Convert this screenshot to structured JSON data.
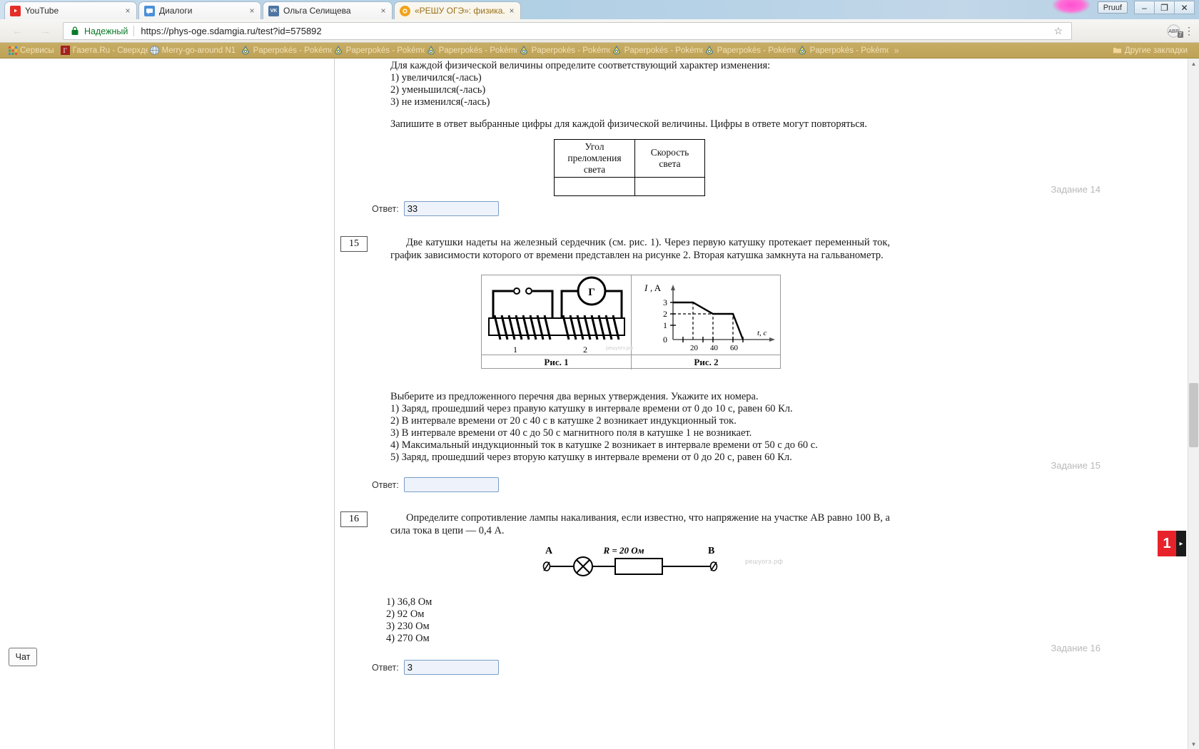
{
  "browser": {
    "tabs": [
      {
        "title": "YouTube",
        "favicon": "youtube-icon",
        "close": "×",
        "active": false
      },
      {
        "title": "Диалоги",
        "favicon": "message-icon",
        "close": "×",
        "active": false
      },
      {
        "title": "Ольга Селищева",
        "favicon": "vk-icon",
        "close": "×",
        "active": false
      },
      {
        "title": "«РЕШУ ОГЭ»: физика. О",
        "favicon": "sun-icon",
        "close": "×",
        "active": true
      }
    ],
    "window_controls": {
      "minimize": "–",
      "maximize": "❐",
      "close": "✕"
    },
    "pruuf_badge": "Pruuf",
    "omnibox": {
      "secure_label": "Надежный",
      "url": "https://phys-oge.sdamgia.ru/test?id=575892",
      "star": "☆",
      "lock": "lock-icon"
    },
    "extensions": {
      "abp_label": "ABP",
      "abp_count": "7",
      "menu": "⋮"
    },
    "bookmarks": [
      {
        "label": "Сервисы",
        "icon": "apps-grid-icon"
      },
      {
        "label": "Газета.Ru - Сверхдер",
        "icon": "gazeta-icon"
      },
      {
        "label": "Merry-go-around N1",
        "icon": "globe-icon"
      },
      {
        "label": "Paperpokés - Pokémo",
        "icon": "pokeball-icon"
      },
      {
        "label": "Paperpokés - Pokémo",
        "icon": "pokeball-icon"
      },
      {
        "label": "Paperpokés - Pokémo",
        "icon": "pokeball-icon"
      },
      {
        "label": "Paperpokés - Pokémo",
        "icon": "pokeball-icon"
      },
      {
        "label": "Paperpokés - Pokémo",
        "icon": "pokeball-icon"
      },
      {
        "label": "Paperpokés - Pokémo",
        "icon": "pokeball-icon"
      },
      {
        "label": "Paperpokés - Pokémo",
        "icon": "pokeball-icon"
      }
    ],
    "bookmarks_overflow": "»",
    "other_bookmarks": {
      "label": "Другие закладки",
      "icon": "folder-icon"
    }
  },
  "task14": {
    "intro": "Для каждой физической величины определите соответствующий характер изменения:",
    "options": [
      "1) увеличился(-лась)",
      "2) уменьшился(-лась)",
      "3) не изменился(-лась)"
    ],
    "instruction": "Запишите в ответ выбранные цифры для каждой физической величины. Цифры в ответе могут повторяться.",
    "table": {
      "headers": [
        "Угол преломления света",
        "Скорость света"
      ],
      "row": [
        "",
        ""
      ]
    },
    "task_label": "Задание 14",
    "answer_label": "Ответ:",
    "answer_value": "33"
  },
  "task15": {
    "number": "15",
    "text": "Две катушки надеты на железный сердечник (см. рис. 1). Через первую катушку протекает переменный ток, график зависимости которого от времени представлен на рисунке 2. Вторая катушка замкнута на гальванометр.",
    "figure": {
      "left_caption": "Рис. 1",
      "right_caption": "Рис. 2",
      "coil_labels": [
        "1",
        "2"
      ],
      "galvanometer_label": "Г",
      "watermark": "решуогэ.рф"
    },
    "chart_data": {
      "type": "line",
      "title": "",
      "xlabel": "t, с",
      "ylabel": "I, A",
      "x": [
        0,
        20,
        40,
        50,
        60
      ],
      "y": [
        3,
        3,
        2,
        2,
        0
      ],
      "xticks": [
        20,
        40,
        60
      ],
      "yticks": [
        0,
        1,
        2,
        3
      ],
      "xlim": [
        0,
        68
      ],
      "ylim": [
        0,
        3.6
      ],
      "grid": false,
      "dashed_guides": [
        {
          "from": [
            0,
            2
          ],
          "to": [
            40,
            2
          ]
        },
        {
          "from": [
            20,
            0
          ],
          "to": [
            20,
            3
          ]
        },
        {
          "from": [
            40,
            0
          ],
          "to": [
            40,
            2
          ]
        },
        {
          "from": [
            50,
            0
          ],
          "to": [
            50,
            2
          ]
        }
      ],
      "legend": ""
    },
    "instruction": "Выберите из предложенного перечня два верных утверждения. Укажите их номера.",
    "options": [
      "1) Заряд, прошедший через правую катушку в интервале времени от 0 до 10 с, равен 60 Кл.",
      "2) В интервале времени от 20 с 40 с в катушке 2 возникает индукционный ток.",
      "3) В интервале времени от 40 с до 50 с магнитного поля в катушке 1 не возникает.",
      "4) Максимальный индукционный ток в катушке 2 возникает в интервале времени от 50 с до 60 с.",
      "5) Заряд, прошедший через вторую катушку в интервале времени от 0 до 20 с, равен 60 Кл."
    ],
    "task_label": "Задание 15",
    "answer_label": "Ответ:",
    "answer_value": ""
  },
  "task16": {
    "number": "16",
    "text": "Определите сопротивление лампы накаливания, если известно, что напряжение на участке AB равно 100 В, а сила тока в цепи — 0,4 А.",
    "figure": {
      "point_a": "A",
      "point_b": "B",
      "resistor_label": "R = 20 Ом",
      "lamp": "lamp-icon",
      "watermark": "решуогэ.рф"
    },
    "options": [
      "1) 36,8 Ом",
      "2) 92 Ом",
      "3) 230 Ом",
      "4) 270 Ом"
    ],
    "task_label": "Задание 16",
    "answer_label": "Ответ:",
    "answer_value": "3"
  },
  "chat_button": "Чат",
  "side_widget": {
    "label": "1",
    "arrow": "▸"
  },
  "colors": {
    "bookmark_bar": "#c7ad64",
    "secure_green": "#0b7a28",
    "answer_border": "#7a9cc6",
    "task_label_gray": "#b9b9b9",
    "side_red": "#e8222a"
  }
}
